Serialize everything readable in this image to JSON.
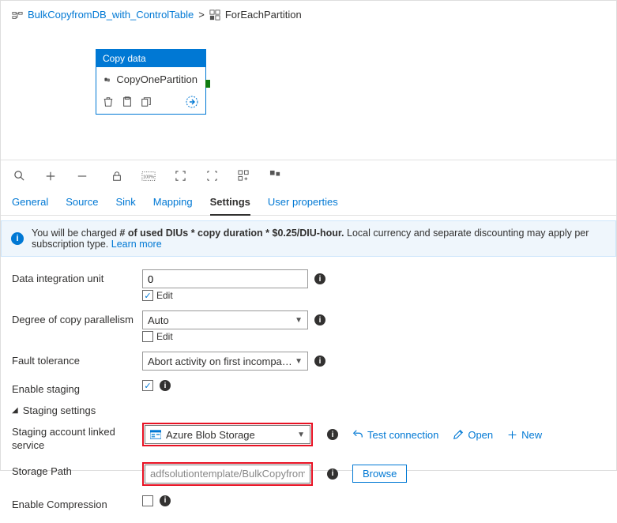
{
  "breadcrumb": {
    "parent": "BulkCopyfromDB_with_ControlTable",
    "current": "ForEachPartition"
  },
  "activity": {
    "type_label": "Copy data",
    "name": "CopyOnePartition"
  },
  "tabs": {
    "general": "General",
    "source": "Source",
    "sink": "Sink",
    "mapping": "Mapping",
    "settings": "Settings",
    "user_properties": "User properties"
  },
  "infobar": {
    "prefix": "You will be charged ",
    "bold": "# of used DIUs * copy duration * $0.25/DIU-hour.",
    "suffix": " Local currency and separate discounting may apply per subscription type. ",
    "learn_more": "Learn more"
  },
  "form": {
    "diu_label": "Data integration unit",
    "diu_value": "0",
    "edit_label": "Edit",
    "dcp_label": "Degree of copy parallelism",
    "dcp_value": "Auto",
    "fault_label": "Fault tolerance",
    "fault_value": "Abort activity on first incompatible row",
    "staging_label": "Enable staging",
    "staging_settings_label": "Staging settings",
    "linked_service_label": "Staging account linked service",
    "linked_service_value": "Azure Blob Storage",
    "test_connection": "Test connection",
    "open": "Open",
    "new": "New",
    "storage_path_label": "Storage Path",
    "storage_path_value": "adfsolutiontemplate/BulkCopyfromDB_with_Co",
    "browse": "Browse",
    "compression_label": "Enable Compression"
  }
}
